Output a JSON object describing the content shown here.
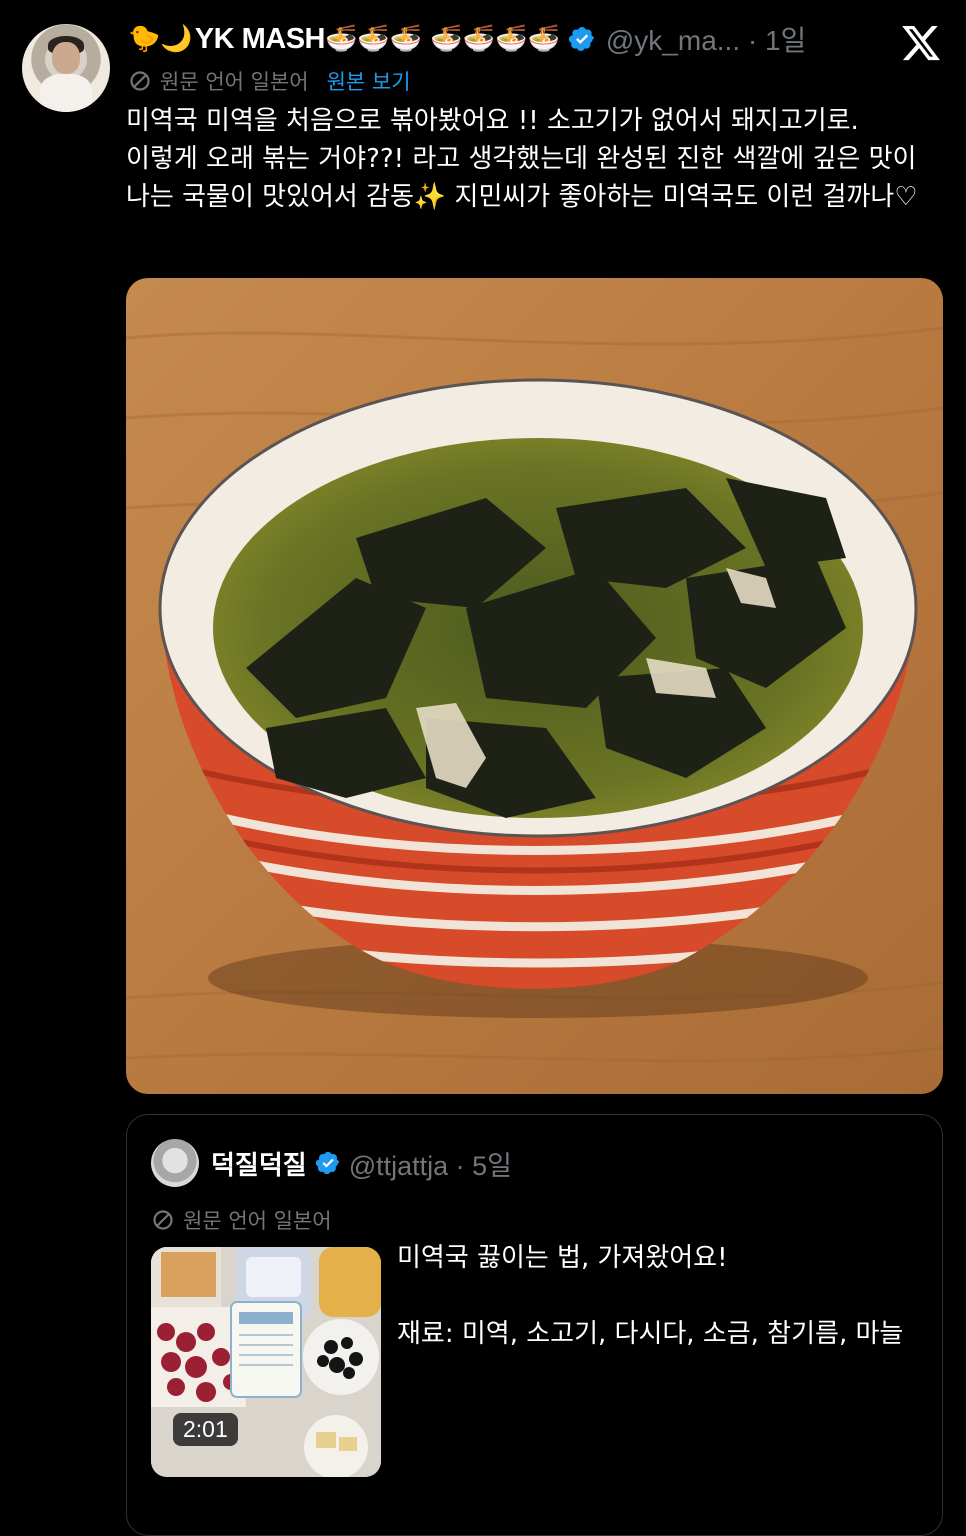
{
  "post": {
    "display_name_prefix_emoji": "🐤🌙",
    "display_name": "YK MASH",
    "display_name_suffix_emoji": "🍜🍜🍜 🍜🍜🍜🍜",
    "handle_and_time": "@yk_ma... · 1일",
    "translation_notice": "원문 언어 일본어",
    "show_original_label": "원본 보기",
    "text": "미역국 미역을 처음으로 볶아봤어요 !!  소고기가 없어서 돼지고기로. 이렇게 오래 볶는 거야??! 라고 생각했는데 완성된 진한 색깔에 깊은 맛이 나는 국물이 맛있어서 감동✨ 지민씨가 좋아하는 미역국도 이런 걸까나♡"
  },
  "quoted_post": {
    "display_name": "덕질덕질",
    "handle_and_time": "@ttjattja · 5일",
    "translation_notice": "원문 언어 일본어",
    "video_duration": "2:01",
    "text_line1": "미역국 끓이는 법, 가져왔어요!",
    "text_line2": "재료: 미역, 소고기, 다시다, 소금, 참기름, 마늘"
  },
  "colors": {
    "background": "#000000",
    "text_primary": "#ffffff",
    "text_secondary": "#71767b",
    "link": "#1d9bf0",
    "verified": "#1d9bf0",
    "border": "#2f3336"
  },
  "icons": [
    "verified-badge-icon",
    "x-logo-icon",
    "translate-icon"
  ]
}
